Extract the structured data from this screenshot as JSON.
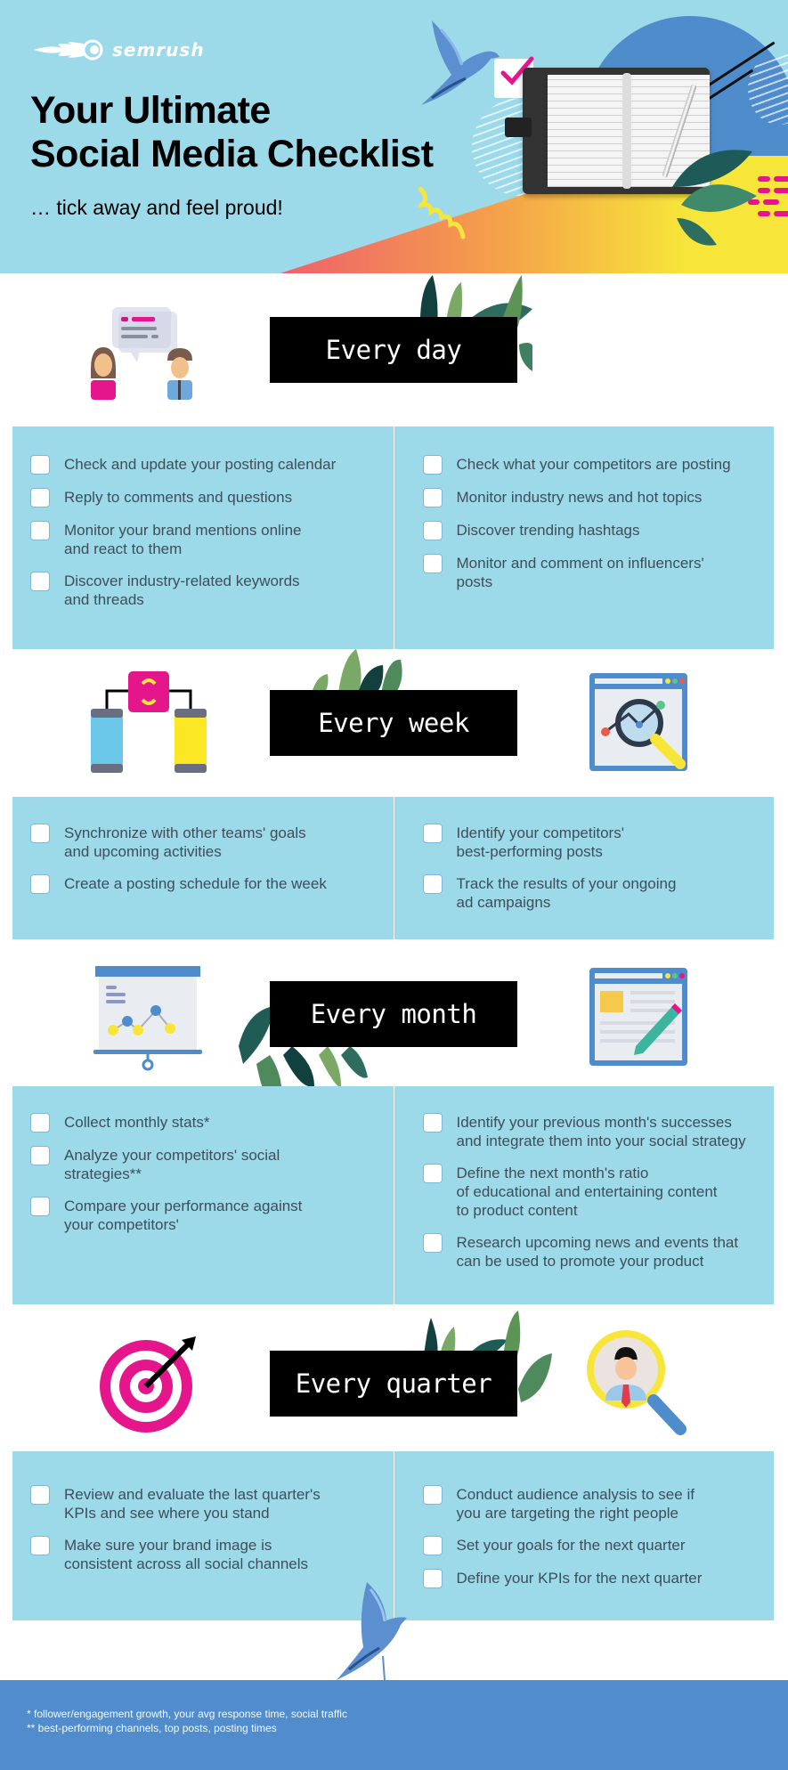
{
  "brand": {
    "logo_text": "semrush"
  },
  "header": {
    "title_line1": "Your Ultimate",
    "title_line2": "Social Media Checklist",
    "subtitle": "… tick away and feel proud!"
  },
  "colors": {
    "sky_blue": "#9cdaea",
    "panel_blue": "#9cdaea",
    "deep_blue": "#518dcc",
    "magenta": "#e5168c",
    "yellow": "#f7e53a",
    "label_bg": "#000000",
    "text": "#3f4d59"
  },
  "sections": [
    {
      "label": "Every day",
      "icons": [
        "chat-people-icon"
      ],
      "left": [
        "Check and update your posting calendar",
        "Reply to comments and questions",
        "Monitor your brand mentions online\nand react to them",
        "Discover industry-related keywords\nand threads"
      ],
      "right": [
        "Check what your competitors are posting",
        "Monitor industry news and hot topics",
        "Discover trending hashtags",
        "Monitor and comment on influencers'\nposts"
      ]
    },
    {
      "label": "Every week",
      "icons": [
        "phone-sync-icon",
        "browser-analytics-icon"
      ],
      "left": [
        "Synchronize with other teams' goals\nand upcoming activities",
        "Create a posting schedule for the week"
      ],
      "right": [
        "Identify your competitors'\nbest-performing posts",
        "Track the results of your ongoing\nad campaigns"
      ]
    },
    {
      "label": "Every month",
      "icons": [
        "presentation-chart-icon",
        "document-edit-icon"
      ],
      "left": [
        "Collect monthly stats*",
        "Analyze your competitors' social\nstrategies**",
        "Compare your performance against\nyour competitors'"
      ],
      "right": [
        "Identify your previous month's successes\nand integrate them into your social strategy",
        "Define the next month's ratio\nof educational and entertaining content\nto product content",
        "Research upcoming news and events that\ncan be used to promote your product"
      ]
    },
    {
      "label": "Every quarter",
      "icons": [
        "target-icon",
        "user-search-icon"
      ],
      "left": [
        "Review and evaluate the last quarter's\nKPIs and see where you stand",
        "Make sure your brand image is\nconsistent across all social channels"
      ],
      "right": [
        "Conduct audience analysis to see if\nyou are targeting the right people",
        "Set your goals for the next quarter",
        "Define your KPIs for the next quarter"
      ]
    }
  ],
  "footnotes": [
    "* follower/engagement growth, your avg response time, social traffic",
    "** best-performing channels, top posts, posting times"
  ]
}
